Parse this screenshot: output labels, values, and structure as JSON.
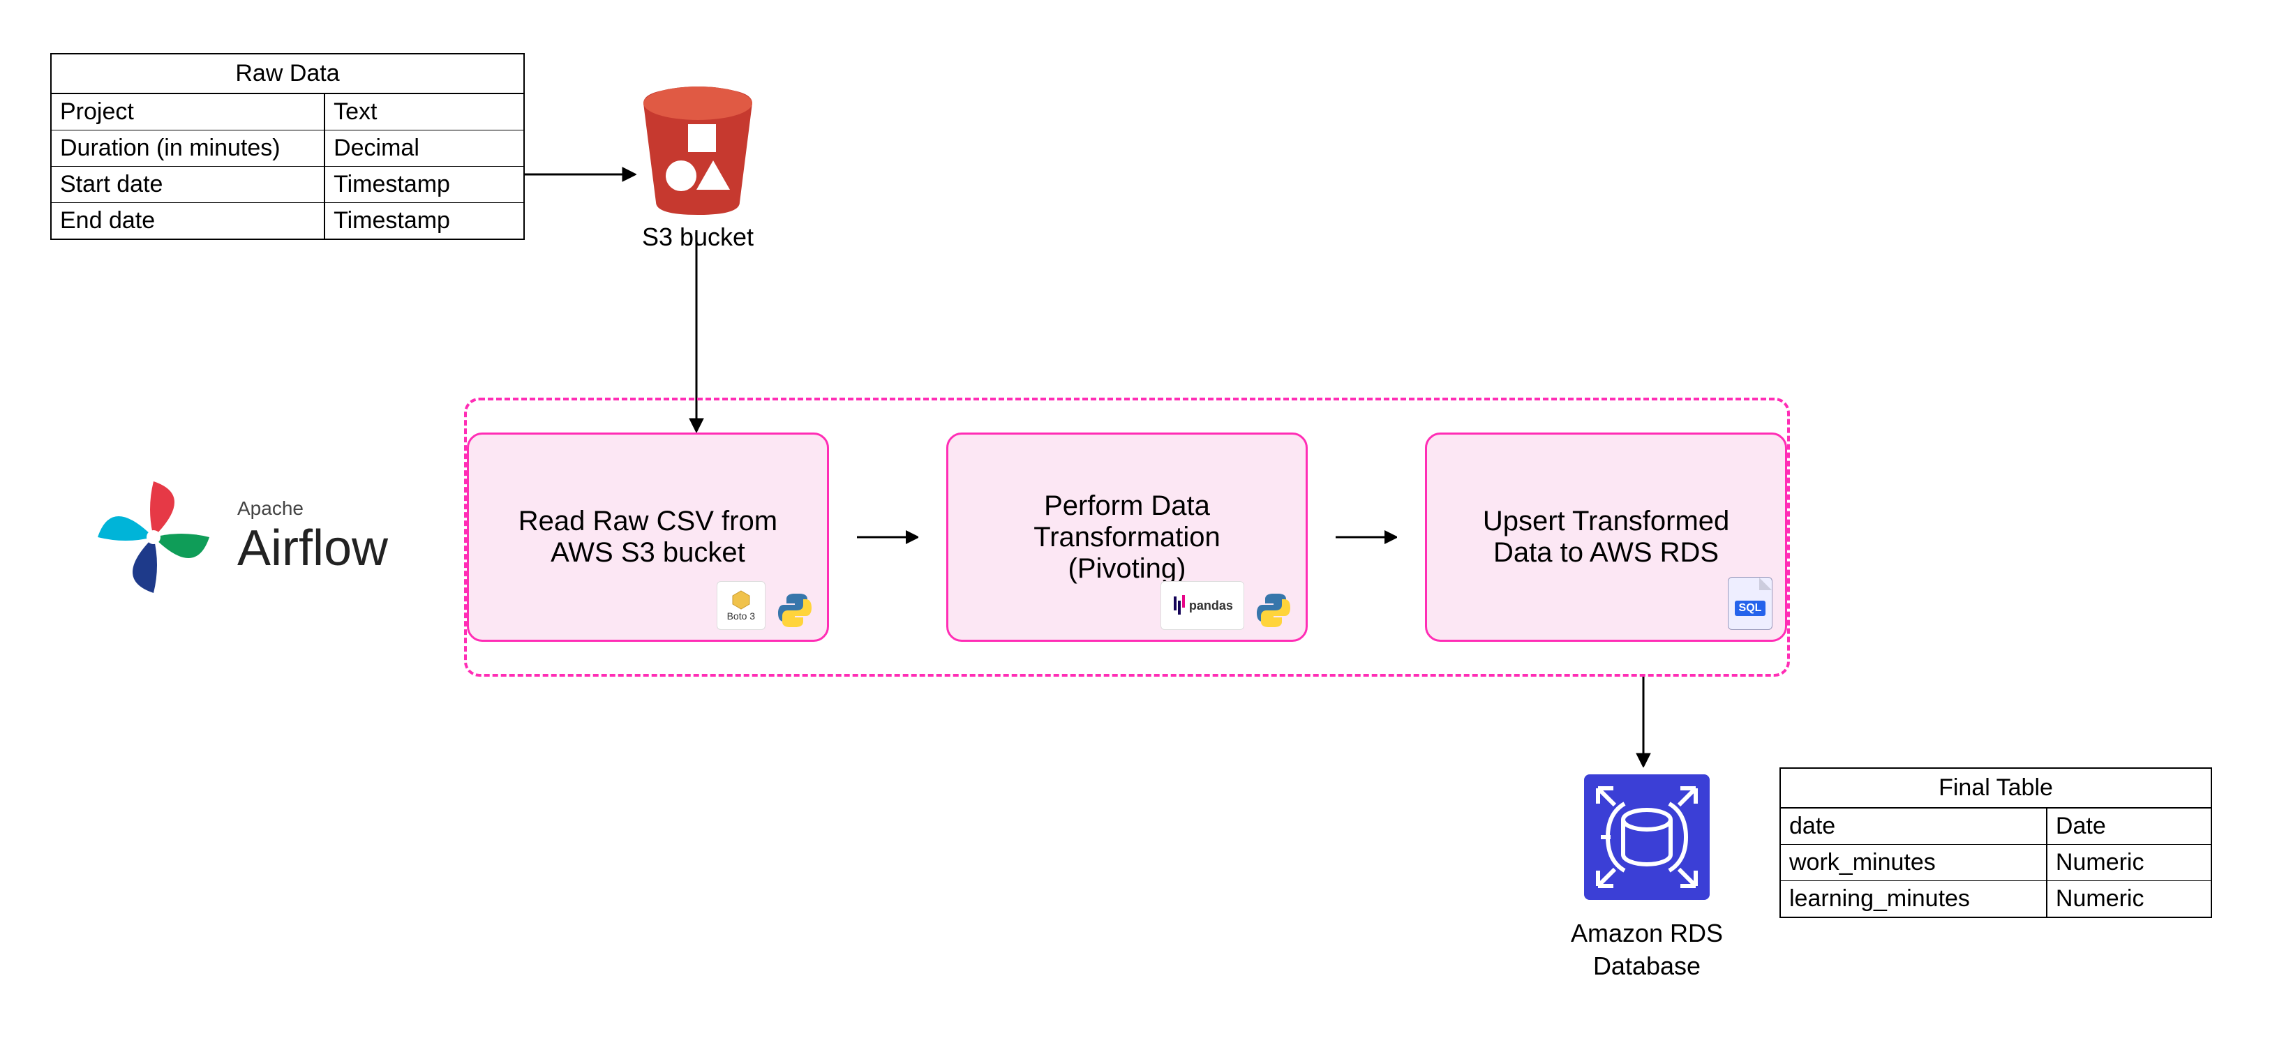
{
  "raw_table": {
    "title": "Raw Data",
    "rows": [
      {
        "name": "Project",
        "type": "Text"
      },
      {
        "name": "Duration (in minutes)",
        "type": "Decimal"
      },
      {
        "name": "Start date",
        "type": "Timestamp"
      },
      {
        "name": "End date",
        "type": "Timestamp"
      }
    ]
  },
  "s3": {
    "label": "S3 bucket"
  },
  "airflow": {
    "brand_small": "Apache",
    "brand_big": "Airflow",
    "tasks": [
      {
        "label": "Read Raw CSV from AWS S3 bucket",
        "tools": [
          "Boto 3",
          "Python"
        ]
      },
      {
        "label": "Perform Data Transformation (Pivoting)",
        "tools": [
          "pandas",
          "Python"
        ]
      },
      {
        "label": "Upsert Transformed Data to AWS RDS",
        "tools": [
          "SQL"
        ]
      }
    ]
  },
  "rds": {
    "label": "Amazon RDS Database"
  },
  "final_table": {
    "title": "Final Table",
    "rows": [
      {
        "name": "date",
        "type": "Date"
      },
      {
        "name": "work_minutes",
        "type": "Numeric"
      },
      {
        "name": "learning_minutes",
        "type": "Numeric"
      }
    ]
  },
  "icons": {
    "s3_bucket": "s3-bucket-icon",
    "rds_db": "rds-database-icon",
    "airflow_pinwheel": "airflow-pinwheel-icon",
    "boto3": "boto3-icon",
    "python": "python-icon",
    "pandas": "pandas-icon",
    "sql_file": "sql-file-icon"
  },
  "colors": {
    "pink_border": "#ff2db5",
    "pink_fill": "#fce7f4",
    "s3_red": "#c6392f",
    "s3_red_light": "#e05a44",
    "rds_blue": "#3b3fd6"
  }
}
